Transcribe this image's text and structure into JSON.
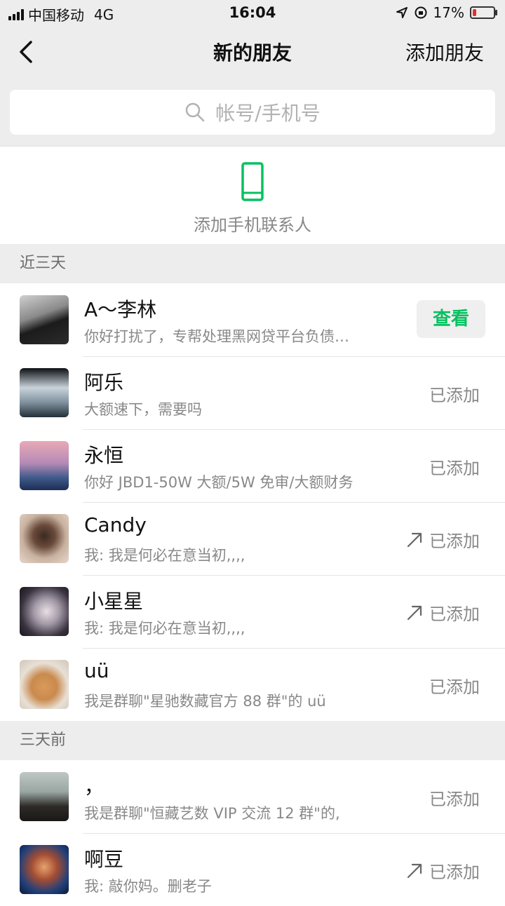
{
  "status_bar": {
    "carrier": "中国移动",
    "network": "4G",
    "time": "16:04",
    "battery": "17%",
    "battery_level": 0.17
  },
  "nav": {
    "title": "新的朋友",
    "add_label": "添加朋友"
  },
  "search": {
    "placeholder": "帐号/手机号"
  },
  "phone_contacts": {
    "label": "添加手机联系人"
  },
  "sections": [
    {
      "header": "近三天",
      "items": [
        {
          "name": "A～李林",
          "message": "你好打扰了，专帮处理黑网贷平台负债…",
          "action": "查看"
        },
        {
          "name": "阿乐",
          "message": "大额速下，需要吗",
          "status": "已添加"
        },
        {
          "name": "永恒",
          "message": "你好 JBD1-50W  大额/5W 免审/大额财务",
          "status": "已添加"
        },
        {
          "name": "Candy",
          "message": "我: 我是何必在意当初,,,,",
          "status": "已添加"
        },
        {
          "name": "小星星",
          "message": "我: 我是何必在意当初,,,,",
          "status": "已添加"
        },
        {
          "name": "uü",
          "message": "我是群聊\"星驰数藏官方 88 群\"的 uü",
          "status": "已添加"
        }
      ]
    },
    {
      "header": "三天前",
      "items": [
        {
          "name": "，",
          "message": "我是群聊\"恒藏艺数 VIP 交流 12 群\"的,",
          "status": "已添加"
        },
        {
          "name": "啊豆",
          "message": "我: 敲你妈。删老子",
          "status": "已添加"
        }
      ]
    }
  ],
  "colors": {
    "accent": "#07c160",
    "background": "#ededed"
  }
}
